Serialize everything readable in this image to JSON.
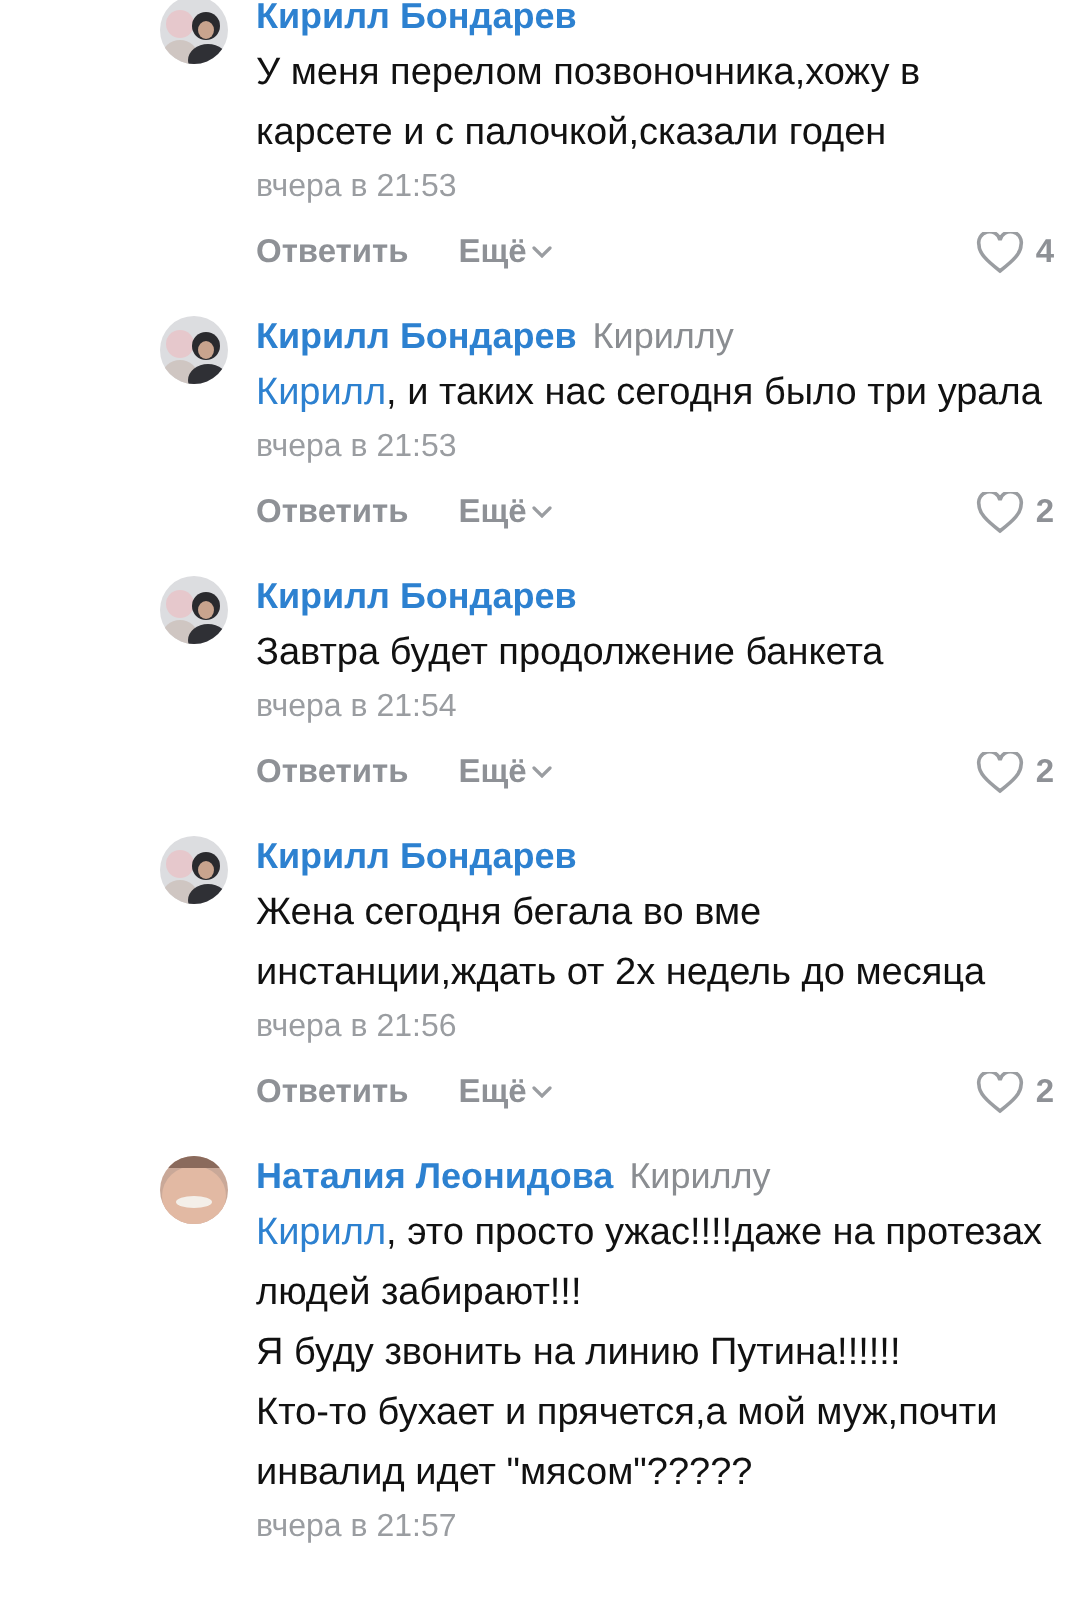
{
  "comments": [
    {
      "author": "Кирилл Бондарев",
      "text": "У меня перелом позвоночника,хожу в карсете и с палочкой,сказали годен",
      "time": "вчера в 21:53",
      "reply": "Ответить",
      "more": "Ещё",
      "likes": "4"
    },
    {
      "author": "Кирилл Бондарев",
      "reply_to": "Кириллу",
      "mention": "Кирилл",
      "text": ", и таких нас сегодня было три урала",
      "time": "вчера в 21:53",
      "reply": "Ответить",
      "more": "Ещё",
      "likes": "2"
    },
    {
      "author": "Кирилл Бондарев",
      "text": "Завтра будет продолжение банкета",
      "time": "вчера в 21:54",
      "reply": "Ответить",
      "more": "Ещё",
      "likes": "2"
    },
    {
      "author": "Кирилл Бондарев",
      "text": "Жена сегодня бегала во вме инстанции,ждать от 2х недель до месяца",
      "time": "вчера в 21:56",
      "reply": "Ответить",
      "more": "Ещё",
      "likes": "2"
    },
    {
      "author": "Наталия Леонидова",
      "reply_to": "Кириллу",
      "mention": "Кирилл",
      "text": ", это просто ужас!!!!даже на протезах людей забирают!!!\nЯ буду звонить на линию Путина!!!!!!\nКто-то бухает и прячется,а мой муж,почти инвалид идет \"мясом\"?????",
      "time": "вчера в 21:57"
    }
  ]
}
